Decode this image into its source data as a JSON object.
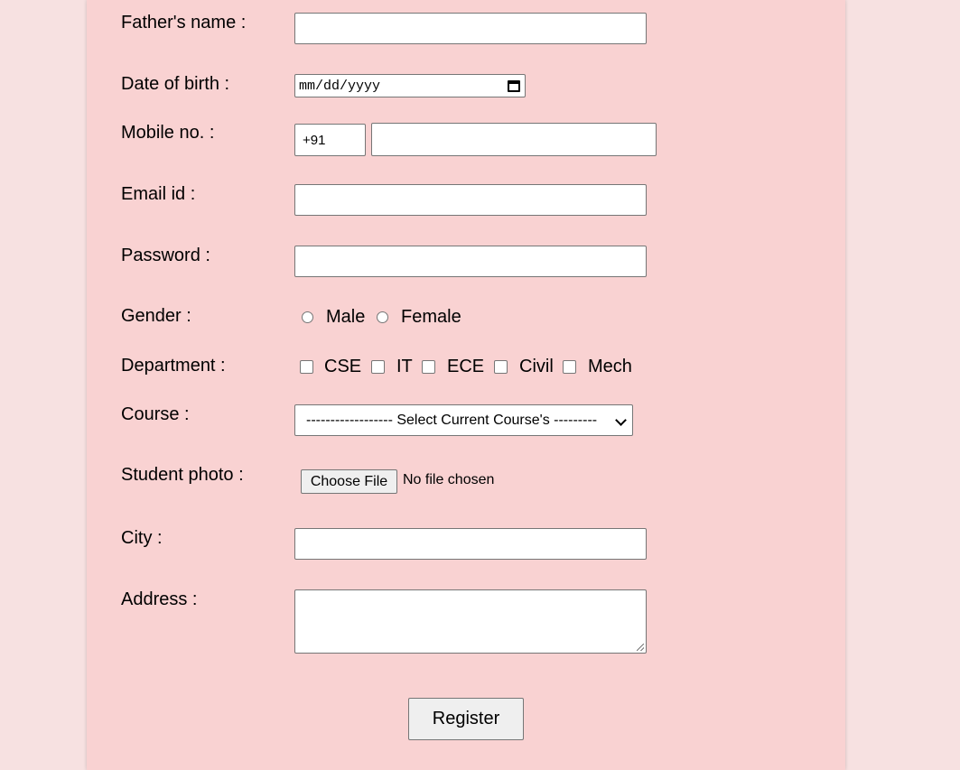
{
  "form": {
    "fathers_name": {
      "label": "Father's name :",
      "value": ""
    },
    "dob": {
      "label": "Date of birth :",
      "placeholder": "mm/dd/yyyy"
    },
    "mobile": {
      "label": "Mobile no. :",
      "country_code": "+91",
      "value": ""
    },
    "email": {
      "label": "Email id :",
      "value": ""
    },
    "password": {
      "label": "Password :",
      "value": ""
    },
    "gender": {
      "label": "Gender :",
      "options": [
        "Male",
        "Female"
      ]
    },
    "department": {
      "label": "Department :",
      "options": [
        "CSE",
        "IT",
        "ECE",
        "Civil",
        "Mech"
      ]
    },
    "course": {
      "label": "Course :",
      "selected": "------------------ Select Current Course's ---------"
    },
    "photo": {
      "label": "Student photo :",
      "button_label": "Choose File",
      "status": "No file chosen"
    },
    "city": {
      "label": "City :",
      "value": ""
    },
    "address": {
      "label": "Address :",
      "value": ""
    },
    "register_label": "Register"
  },
  "colors": {
    "page_background": "#f7e1e1",
    "panel_background": "#f9d2d2",
    "button_background": "#efefef"
  }
}
